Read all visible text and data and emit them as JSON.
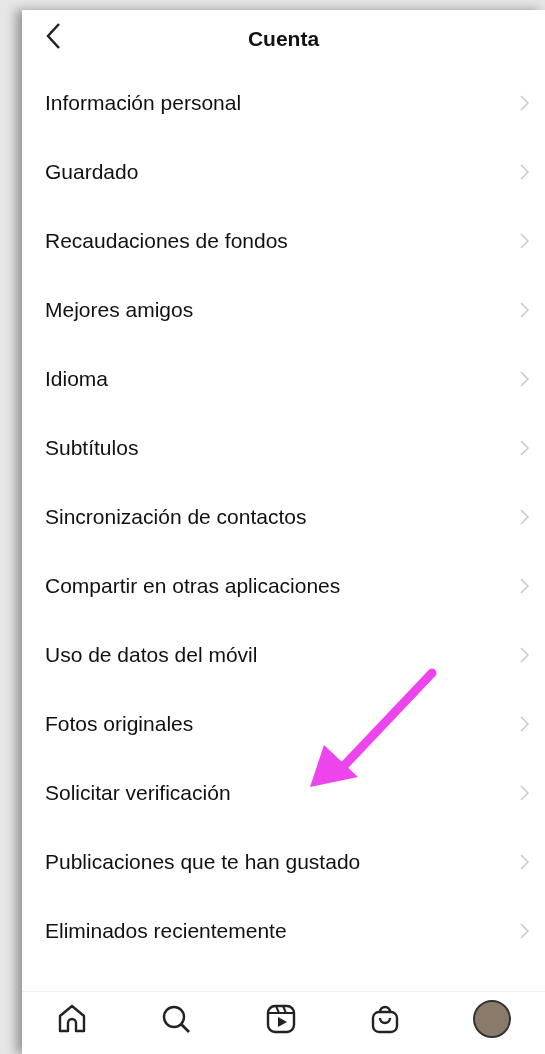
{
  "header": {
    "title": "Cuenta"
  },
  "items": [
    {
      "label": "Información personal"
    },
    {
      "label": "Guardado"
    },
    {
      "label": "Recaudaciones de fondos"
    },
    {
      "label": "Mejores amigos"
    },
    {
      "label": "Idioma"
    },
    {
      "label": "Subtítulos"
    },
    {
      "label": "Sincronización de contactos"
    },
    {
      "label": "Compartir en otras aplicaciones"
    },
    {
      "label": "Uso de datos del móvil"
    },
    {
      "label": "Fotos originales"
    },
    {
      "label": "Solicitar verificación"
    },
    {
      "label": "Publicaciones que te han gustado"
    },
    {
      "label": "Eliminados recientemente"
    }
  ],
  "nav": [
    {
      "kind": "home"
    },
    {
      "kind": "search"
    },
    {
      "kind": "reels"
    },
    {
      "kind": "shop"
    },
    {
      "kind": "profile"
    }
  ]
}
